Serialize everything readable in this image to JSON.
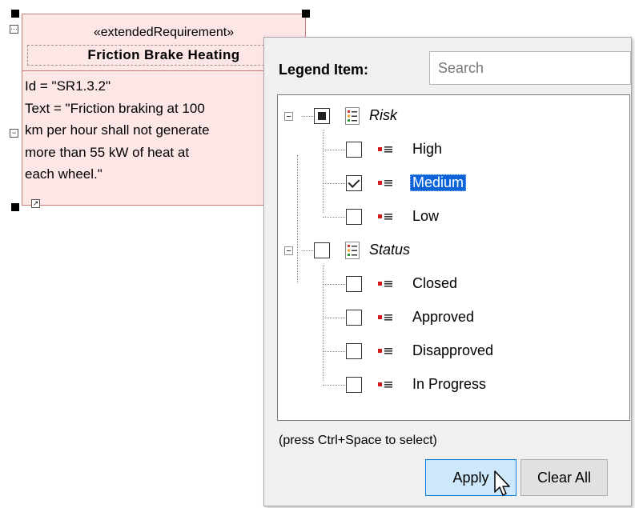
{
  "requirement": {
    "stereotype": "«extendedRequirement»",
    "name": "Friction Brake Heating",
    "body_lines": [
      "Id = \"SR1.3.2\"",
      "Text = \"Friction braking at 100",
      "km per hour shall not generate",
      "more than 55 kW of heat at",
      "each wheel.\""
    ]
  },
  "popup": {
    "legend_item_label": "Legend Item:",
    "search": {
      "placeholder": "Search",
      "value": ""
    },
    "tree": {
      "groups": [
        {
          "label": "Risk",
          "state": "partial",
          "items": [
            {
              "label": "High",
              "checked": false
            },
            {
              "label": "Medium",
              "checked": true,
              "selected": true
            },
            {
              "label": "Low",
              "checked": false
            }
          ]
        },
        {
          "label": "Status",
          "state": "unchecked",
          "items": [
            {
              "label": "Closed",
              "checked": false
            },
            {
              "label": "Approved",
              "checked": false
            },
            {
              "label": "Disapproved",
              "checked": false
            },
            {
              "label": "In Progress",
              "checked": false
            }
          ]
        }
      ]
    },
    "hint": "(press Ctrl+Space to select)",
    "apply_label": "Apply",
    "clear_all_label": "Clear All"
  },
  "colors": {
    "element_fill": "#fde6e6",
    "element_border": "#c97c7c",
    "selection": "#0a64d8",
    "item_icon_red": "#d11a1a",
    "apply_button_fill": "#cde8fb"
  },
  "icons": {
    "group": "legend-list-icon",
    "item": "legend-item-icon",
    "expander": "collapse-minus-icon",
    "cursor": "mouse-pointer-icon"
  }
}
